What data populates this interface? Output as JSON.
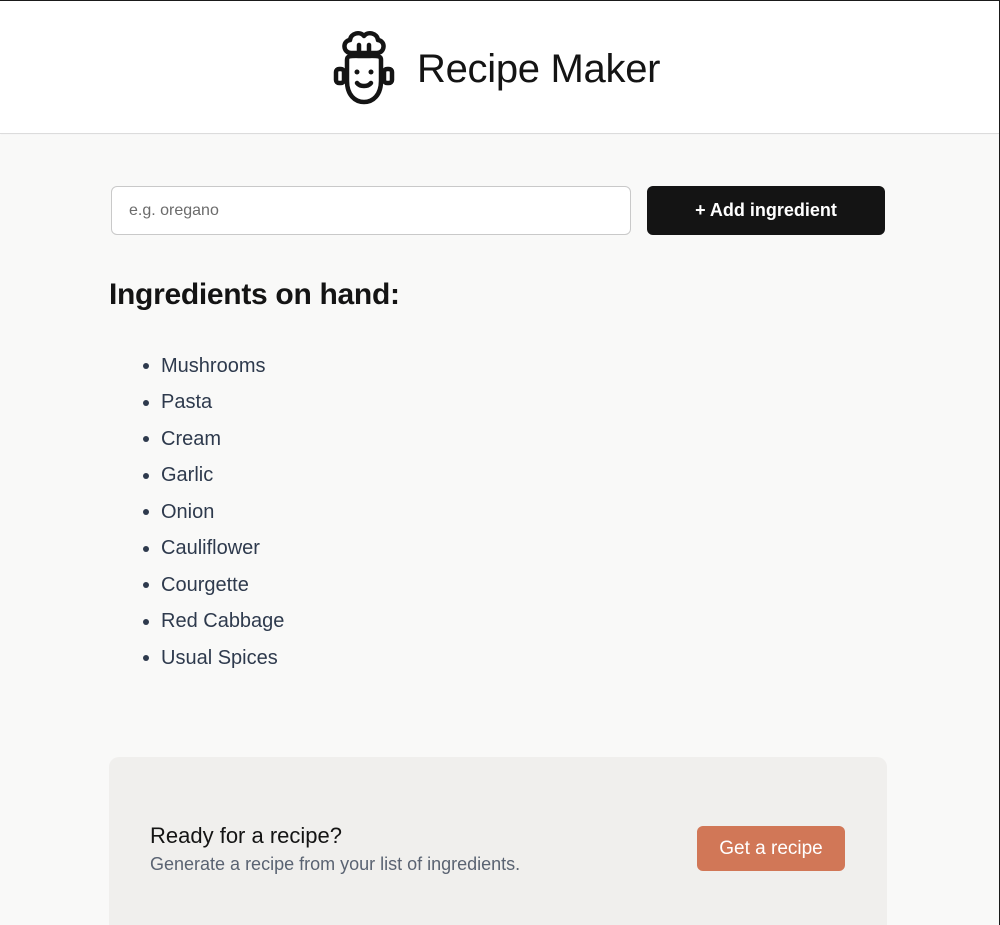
{
  "header": {
    "logo_icon": "chef-robot-icon",
    "title": "Recipe Maker"
  },
  "form": {
    "input_placeholder": "e.g. oregano",
    "input_value": "",
    "add_button_label": "+ Add ingredient"
  },
  "ingredients": {
    "heading": "Ingredients on hand:",
    "items": [
      "Mushrooms",
      "Pasta",
      "Cream",
      "Garlic",
      "Onion",
      "Cauliflower",
      "Courgette",
      "Red Cabbage",
      "Usual Spices"
    ]
  },
  "cta": {
    "title": "Ready for a recipe?",
    "subtitle": "Generate a recipe from your list of ingredients.",
    "button_label": "Get a recipe"
  },
  "colors": {
    "primary_button": "#141414",
    "accent_button": "#d17757",
    "page_background": "#f9f9f8",
    "panel_background": "#f0efed",
    "list_text": "#2e3a4d"
  }
}
